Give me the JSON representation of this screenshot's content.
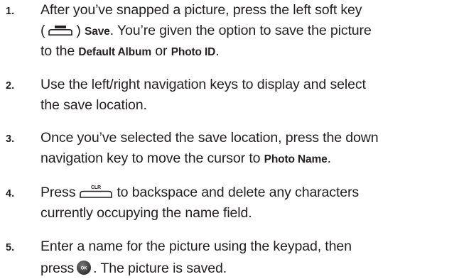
{
  "steps": [
    {
      "number": "1.",
      "line1": {
        "a": "After you’ve snapped a picture, press the left soft key"
      },
      "line2": {
        "a": "(",
        "b": ")",
        "c": "Save",
        "d": ". You’re given the option to save the picture"
      },
      "line3": {
        "a": "to the ",
        "b": "Default Album",
        "c": " or ",
        "d": "Photo ID",
        "e": "."
      }
    },
    {
      "number": "2.",
      "line1": {
        "a": "Use the left/right navigation keys to display and select"
      },
      "line2": {
        "a": "the save location."
      }
    },
    {
      "number": "3.",
      "line1": {
        "a": "Once you’ve selected the save location, press the down"
      },
      "line2": {
        "a": "navigation key to move the cursor to ",
        "b": "Photo Name",
        "c": "."
      }
    },
    {
      "number": "4.",
      "line1": {
        "a": "Press",
        "b": "to backspace and delete any characters"
      },
      "line2": {
        "a": "currently occupying the name field."
      }
    },
    {
      "number": "5.",
      "line1": {
        "a": "Enter a name for the picture using the keypad, then"
      },
      "line2": {
        "a": "press",
        "b": ". The picture is saved."
      }
    }
  ],
  "keys": {
    "clr_label": "CLR",
    "ok_label": "OK",
    "soft_key_icon": "left-soft-key-icon",
    "clr_key_icon": "clr-key-icon",
    "ok_key_icon": "ok-key-icon"
  }
}
